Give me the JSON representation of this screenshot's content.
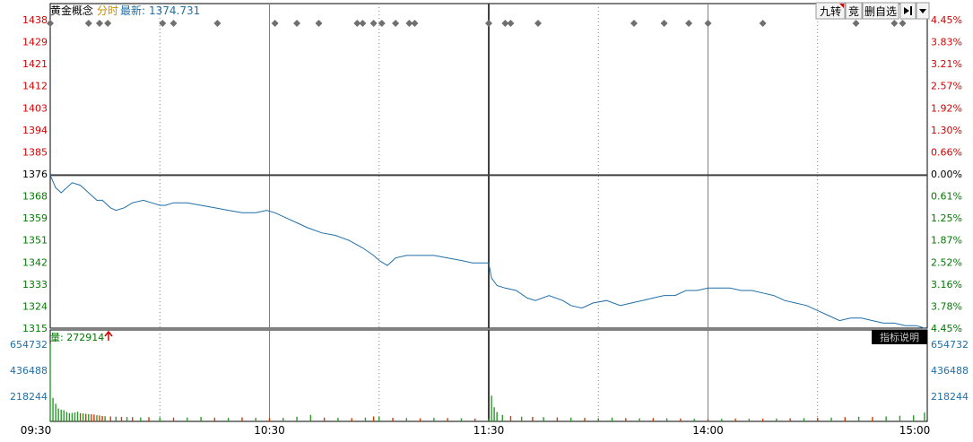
{
  "header": {
    "name": "黄金概念",
    "period": "分时",
    "latest_label": "最新:",
    "latest_value": "1374.731",
    "buttons": [
      "九转",
      "竞",
      "删自选"
    ],
    "nav_icon": "skip-end-icon",
    "menu_icon": "dropdown-arrow-icon"
  },
  "volume_panel": {
    "label": "量: 272914",
    "arrow_icon": "up-arrow-icon",
    "indicator_button": "指标说明"
  },
  "colors": {
    "price_line": "#1f6fa8",
    "up": "#d40000",
    "down": "#007a00",
    "neutral": "#000000",
    "volume_up": "#d23a00",
    "volume_down": "#2a9a2a",
    "marker": "#707070",
    "grid": "#808080",
    "panel_border": "#000000"
  },
  "chart_data": [
    {
      "type": "line",
      "title": "黄金概念",
      "x_tick_labels": [
        "09:30",
        "10:30",
        "11:30",
        "14:00",
        "15:00"
      ],
      "y_ticks_left": [
        {
          "label": "1438",
          "tone": "up"
        },
        {
          "label": "1429",
          "tone": "up"
        },
        {
          "label": "1421",
          "tone": "up"
        },
        {
          "label": "1412",
          "tone": "up"
        },
        {
          "label": "1403",
          "tone": "up"
        },
        {
          "label": "1394",
          "tone": "up"
        },
        {
          "label": "1385",
          "tone": "up"
        },
        {
          "label": "1376",
          "tone": "neutral"
        },
        {
          "label": "1368",
          "tone": "down"
        },
        {
          "label": "1359",
          "tone": "down"
        },
        {
          "label": "1351",
          "tone": "down"
        },
        {
          "label": "1342",
          "tone": "down"
        },
        {
          "label": "1333",
          "tone": "down"
        },
        {
          "label": "1324",
          "tone": "down"
        },
        {
          "label": "1315",
          "tone": "down"
        }
      ],
      "y_ticks_right": [
        {
          "label": "4.45%",
          "tone": "up"
        },
        {
          "label": "3.83%",
          "tone": "up"
        },
        {
          "label": "3.21%",
          "tone": "up"
        },
        {
          "label": "2.57%",
          "tone": "up"
        },
        {
          "label": "1.92%",
          "tone": "up"
        },
        {
          "label": "1.30%",
          "tone": "up"
        },
        {
          "label": "0.66%",
          "tone": "up"
        },
        {
          "label": "0.00%",
          "tone": "neutral"
        },
        {
          "label": "0.61%",
          "tone": "down"
        },
        {
          "label": "1.25%",
          "tone": "down"
        },
        {
          "label": "1.87%",
          "tone": "down"
        },
        {
          "label": "2.52%",
          "tone": "down"
        },
        {
          "label": "3.16%",
          "tone": "down"
        },
        {
          "label": "3.78%",
          "tone": "down"
        },
        {
          "label": "4.45%",
          "tone": "down"
        }
      ],
      "ylim": [
        1315,
        1438
      ],
      "reference_price": 1376,
      "xlim_minutes": [
        0,
        240
      ],
      "grid": true,
      "series": [
        {
          "values": [
            [
              0,
              1376
            ],
            [
              2,
              1371
            ],
            [
              4,
              1369
            ],
            [
              8,
              1373
            ],
            [
              11,
              1372
            ],
            [
              14,
              1369
            ],
            [
              17,
              1366
            ],
            [
              19,
              1366
            ],
            [
              22,
              1363
            ],
            [
              24,
              1362
            ],
            [
              27,
              1363
            ],
            [
              30,
              1365
            ],
            [
              34,
              1366
            ],
            [
              37,
              1365
            ],
            [
              40,
              1364
            ],
            [
              42,
              1364
            ],
            [
              45,
              1365
            ],
            [
              50,
              1365
            ],
            [
              55,
              1364
            ],
            [
              60,
              1363
            ],
            [
              65,
              1362
            ],
            [
              70,
              1361
            ],
            [
              75,
              1361
            ],
            [
              79,
              1362
            ],
            [
              82,
              1361
            ],
            [
              86,
              1359
            ],
            [
              90,
              1357
            ],
            [
              94,
              1355
            ],
            [
              99,
              1353
            ],
            [
              104,
              1352
            ],
            [
              109,
              1350
            ],
            [
              114,
              1347
            ],
            [
              118,
              1344
            ],
            [
              120,
              1342
            ],
            [
              123,
              1340
            ],
            [
              126,
              1343
            ],
            [
              130,
              1344
            ],
            [
              135,
              1344
            ],
            [
              140,
              1344
            ],
            [
              145,
              1343
            ],
            [
              150,
              1342
            ],
            [
              154,
              1341
            ],
            [
              158,
              1341
            ],
            [
              160,
              1341
            ],
            [
              161,
              1335
            ],
            [
              163,
              1332
            ],
            [
              166,
              1331
            ],
            [
              170,
              1330
            ],
            [
              174,
              1327
            ],
            [
              177,
              1326
            ],
            [
              182,
              1328
            ],
            [
              187,
              1326
            ],
            [
              190,
              1324
            ],
            [
              194,
              1323
            ],
            [
              198,
              1325
            ],
            [
              203,
              1326
            ],
            [
              208,
              1324
            ],
            [
              212,
              1325
            ],
            [
              216,
              1326
            ],
            [
              220,
              1327
            ],
            [
              224,
              1328
            ],
            [
              228,
              1328
            ],
            [
              232,
              1330
            ],
            [
              236,
              1330
            ],
            [
              240,
              1331
            ],
            [
              244,
              1331
            ],
            [
              248,
              1331
            ],
            [
              252,
              1330
            ],
            [
              256,
              1330
            ],
            [
              260,
              1329
            ],
            [
              264,
              1328
            ],
            [
              268,
              1326
            ],
            [
              272,
              1325
            ],
            [
              276,
              1324
            ],
            [
              280,
              1322
            ],
            [
              284,
              1320
            ],
            [
              288,
              1318
            ],
            [
              292,
              1319
            ],
            [
              296,
              1319
            ],
            [
              300,
              1318
            ],
            [
              304,
              1317
            ],
            [
              308,
              1317
            ],
            [
              312,
              1316
            ],
            [
              316,
              1316
            ],
            [
              319,
              1315
            ]
          ]
        }
      ],
      "event_markers_minutes": [
        0,
        14,
        18,
        21,
        41,
        45,
        61,
        82,
        90,
        98,
        112,
        114,
        118,
        121,
        126,
        131,
        133,
        160,
        166,
        168,
        178,
        213,
        224,
        233,
        240,
        260,
        294,
        308,
        311
      ]
    },
    {
      "type": "bar",
      "title": "量",
      "y_ticks_left": [
        "654732",
        "436488",
        "218244"
      ],
      "y_ticks_right": [
        "654732",
        "436488",
        "218244"
      ],
      "ylim": [
        0,
        654732
      ],
      "last_value": 272914,
      "series": [
        {
          "values": [
            [
              0,
              654732,
              "down"
            ],
            [
              1,
              200000,
              "down"
            ],
            [
              2,
              150000,
              "down"
            ],
            [
              3,
              110000,
              "down"
            ],
            [
              4,
              100000,
              "down"
            ],
            [
              5,
              95000,
              "down"
            ],
            [
              6,
              80000,
              "down"
            ],
            [
              7,
              70000,
              "down"
            ],
            [
              8,
              72000,
              "down"
            ],
            [
              9,
              75000,
              "down"
            ],
            [
              10,
              82000,
              "down"
            ],
            [
              11,
              70000,
              "up"
            ],
            [
              12,
              68000,
              "down"
            ],
            [
              13,
              64000,
              "up"
            ],
            [
              14,
              62000,
              "down"
            ],
            [
              15,
              60000,
              "up"
            ],
            [
              16,
              58000,
              "up"
            ],
            [
              17,
              52000,
              "down"
            ],
            [
              18,
              50000,
              "up"
            ],
            [
              19,
              46000,
              "up"
            ],
            [
              20,
              44000,
              "down"
            ],
            [
              22,
              42000,
              "up"
            ],
            [
              24,
              40000,
              "down"
            ],
            [
              26,
              38000,
              "up"
            ],
            [
              28,
              37000,
              "down"
            ],
            [
              30,
              36000,
              "up"
            ],
            [
              33,
              34000,
              "down"
            ],
            [
              36,
              36000,
              "up"
            ],
            [
              40,
              34000,
              "down"
            ],
            [
              45,
              32000,
              "up"
            ],
            [
              50,
              33000,
              "down"
            ],
            [
              55,
              38000,
              "down"
            ],
            [
              60,
              32000,
              "up"
            ],
            [
              65,
              30000,
              "down"
            ],
            [
              70,
              34000,
              "up"
            ],
            [
              75,
              30000,
              "down"
            ],
            [
              80,
              28000,
              "up"
            ],
            [
              85,
              30000,
              "down"
            ],
            [
              90,
              40000,
              "down"
            ],
            [
              95,
              55000,
              "down"
            ],
            [
              100,
              32000,
              "up"
            ],
            [
              105,
              30000,
              "down"
            ],
            [
              110,
              28000,
              "up"
            ],
            [
              115,
              32000,
              "down"
            ],
            [
              118,
              42000,
              "up"
            ],
            [
              120,
              38000,
              "down"
            ],
            [
              125,
              30000,
              "up"
            ],
            [
              130,
              28000,
              "down"
            ],
            [
              135,
              26000,
              "up"
            ],
            [
              140,
              30000,
              "down"
            ],
            [
              145,
              28000,
              "up"
            ],
            [
              150,
              26000,
              "down"
            ],
            [
              155,
              24000,
              "up"
            ],
            [
              160,
              24000,
              "down"
            ],
            [
              161,
              218244,
              "down"
            ],
            [
              162,
              120000,
              "down"
            ],
            [
              163,
              80000,
              "down"
            ],
            [
              165,
              55000,
              "down"
            ],
            [
              168,
              45000,
              "up"
            ],
            [
              172,
              40000,
              "down"
            ],
            [
              176,
              38000,
              "up"
            ],
            [
              180,
              36000,
              "down"
            ],
            [
              185,
              34000,
              "up"
            ],
            [
              190,
              32000,
              "down"
            ],
            [
              195,
              30000,
              "up"
            ],
            [
              200,
              28000,
              "down"
            ],
            [
              205,
              32000,
              "down"
            ],
            [
              210,
              28000,
              "up"
            ],
            [
              215,
              26000,
              "down"
            ],
            [
              220,
              28000,
              "up"
            ],
            [
              225,
              26000,
              "down"
            ],
            [
              230,
              24000,
              "up"
            ],
            [
              235,
              22000,
              "down"
            ],
            [
              240,
              20000,
              "up"
            ],
            [
              245,
              22000,
              "down"
            ],
            [
              250,
              24000,
              "up"
            ],
            [
              255,
              22000,
              "down"
            ],
            [
              260,
              22000,
              "up"
            ],
            [
              265,
              24000,
              "down"
            ],
            [
              270,
              26000,
              "up"
            ],
            [
              275,
              28000,
              "down"
            ],
            [
              280,
              30000,
              "up"
            ],
            [
              285,
              32000,
              "down"
            ],
            [
              290,
              36000,
              "up"
            ],
            [
              295,
              40000,
              "down"
            ],
            [
              300,
              38000,
              "up"
            ],
            [
              305,
              42000,
              "down"
            ],
            [
              310,
              48000,
              "down"
            ],
            [
              315,
              52000,
              "down"
            ],
            [
              319,
              75000,
              "down"
            ]
          ]
        }
      ]
    }
  ]
}
